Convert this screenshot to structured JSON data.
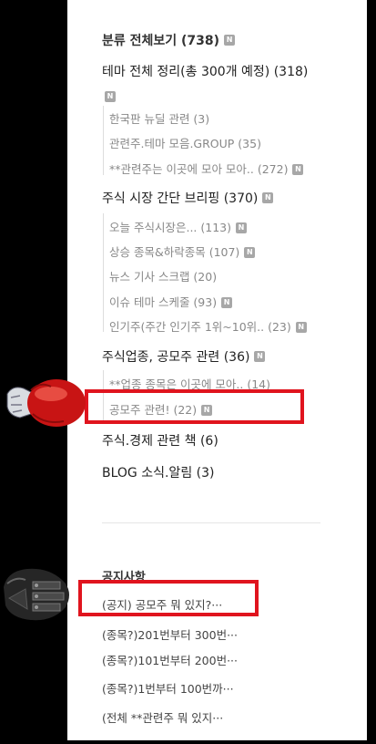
{
  "categories": {
    "all": {
      "label": "분류 전체보기 (738)",
      "badge": "N"
    },
    "theme": {
      "label": "테마 전체 정리(총 300개 예정) (318)",
      "badge": "N",
      "children": [
        {
          "label": "한국판 뉴딜 관련 (3)"
        },
        {
          "label": "관련주.테마 모음.GROUP (35)"
        },
        {
          "label": "**관련주는 이곳에 모아 모아.. (272)",
          "badge": "N"
        }
      ]
    },
    "briefing": {
      "label": "주식 시장 간단 브리핑 (370)",
      "badge": "N",
      "children": [
        {
          "label": "오늘 주식시장은... (113)",
          "badge": "N"
        },
        {
          "label": "상승 종목&하락종목 (107)",
          "badge": "N"
        },
        {
          "label": "뉴스 기사 스크랩 (20)"
        },
        {
          "label": "이슈 테마 스케줄 (93)",
          "badge": "N"
        },
        {
          "label": "인기주(주간 인기주 1위~10위.. (23)",
          "badge": "N"
        }
      ]
    },
    "ipo": {
      "label": "주식업종, 공모주 관련 (36)",
      "badge": "N",
      "children": [
        {
          "label": "**업종 종목은 이곳에 모아.. (14)"
        },
        {
          "label": "공모주 관련! (22)",
          "badge": "N"
        }
      ]
    },
    "books": {
      "label": "주식.경제 관련 책 (6)"
    },
    "blog": {
      "label": "BLOG 소식.알림 (3)"
    }
  },
  "notices": {
    "title": "공지사항",
    "items": [
      {
        "label": "(공지) 공모주 뭐 있지?···"
      },
      {
        "label": "(종목?)201번부터 300번···"
      },
      {
        "label": "(종목?)101번부터 200번···"
      },
      {
        "label": "(종목?)1번부터 100번까···"
      },
      {
        "label": "(전체 **관련주 뭐 있지···"
      }
    ]
  },
  "highlight_color": "#e0141e"
}
